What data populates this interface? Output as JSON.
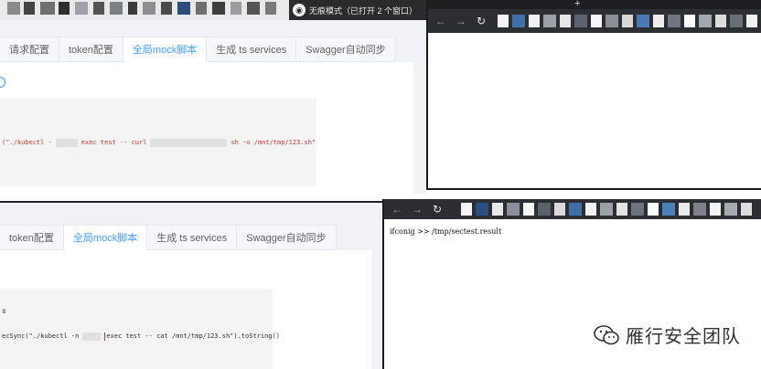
{
  "top_app": {
    "tabs": [
      {
        "label": "请求配置",
        "active": false
      },
      {
        "label": "token配置",
        "active": false
      },
      {
        "label": "全局mock脚本",
        "active": true
      },
      {
        "label": "生成 ts services",
        "active": false
      },
      {
        "label": "Swagger自动同步",
        "active": false
      }
    ],
    "code_parts": [
      "(\"./kubectl -",
      "exec test -- curl",
      "sh -o /mnt/tmp/123.sh\""
    ]
  },
  "incognito": {
    "label": "无痕模式（已打开 2 个窗口）"
  },
  "browser_top": {
    "new_tab": "+"
  },
  "bottom_app": {
    "tabs": [
      {
        "label": "token配置",
        "active": false
      },
      {
        "label": "全局mock脚本",
        "active": true
      },
      {
        "label": "生成 ts services",
        "active": false
      },
      {
        "label": "Swagger自动同步",
        "active": false
      }
    ],
    "code_prefix": "s",
    "code_parts": [
      "ecSync(\"./kubectl -n",
      "exec test -- cat /mnt/tmp/123.sh\").toString()"
    ]
  },
  "browser_bottom": {
    "result": "ifconig >> /tmp/sectest.result"
  },
  "watermark": {
    "text": "雁行安全团队"
  },
  "colors": {
    "accent": "#409eff",
    "code": "#c0392b",
    "browser_dark": "#2d2e31"
  }
}
